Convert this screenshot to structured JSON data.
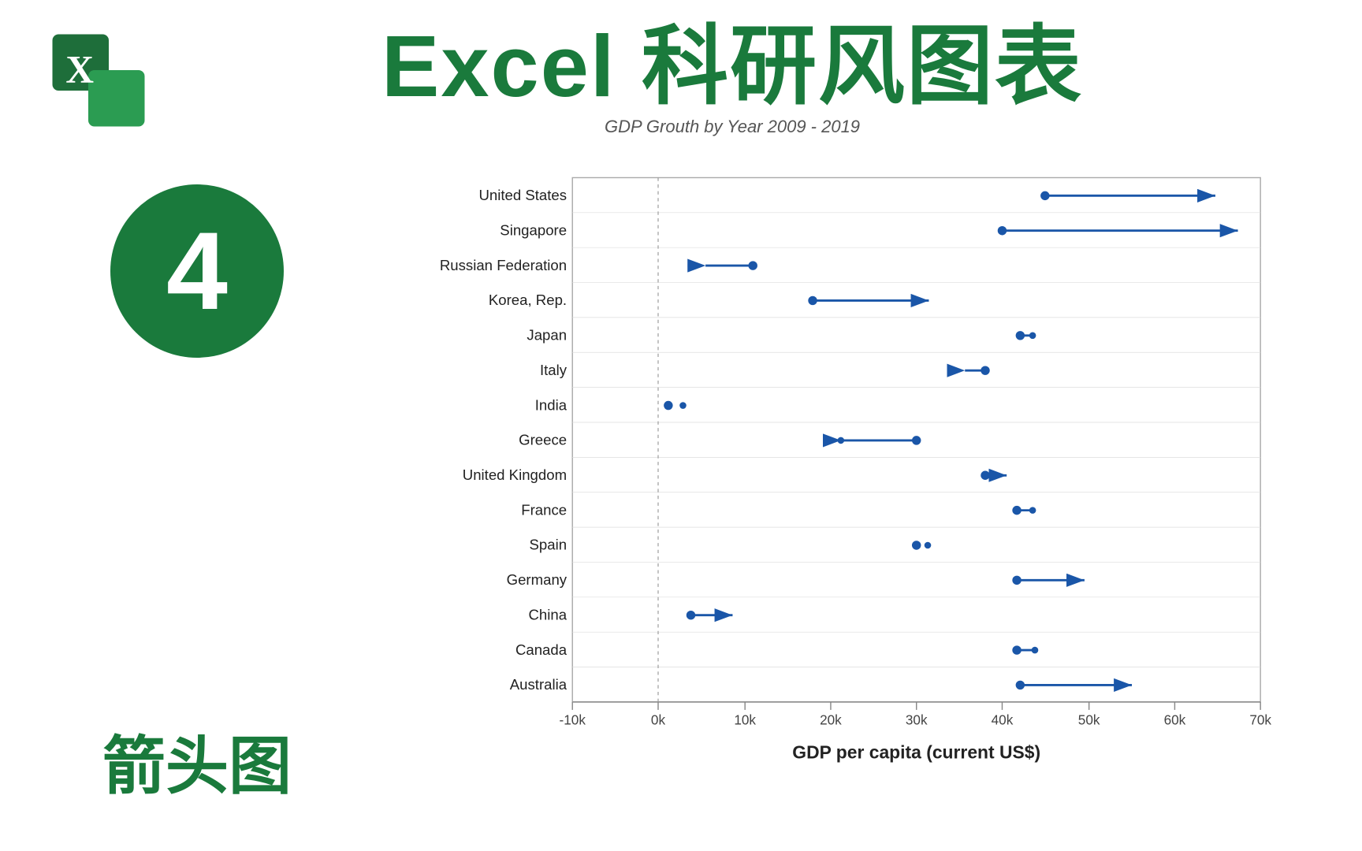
{
  "header": {
    "main_title": "Excel 科研风图表",
    "subtitle": "GDP Grouth by Year 2009 - 2019"
  },
  "left_panel": {
    "number": "4",
    "chart_type": "箭头图"
  },
  "chart": {
    "title": "GDP per capita (current US$)",
    "x_axis_labels": [
      "-10k",
      "0k",
      "10k",
      "20k",
      "30k",
      "40k",
      "50k",
      "60k",
      "70k"
    ],
    "countries": [
      "United States",
      "Singapore",
      "Russian Federation",
      "Korea, Rep.",
      "Japan",
      "Italy",
      "India",
      "Greece",
      "United Kingdom",
      "France",
      "Spain",
      "Germany",
      "China",
      "Canada",
      "Australia"
    ],
    "arrows": [
      {
        "country": "United States",
        "start": 45000,
        "end": 65000
      },
      {
        "country": "Singapore",
        "start": 40000,
        "end": 67000
      },
      {
        "country": "Russian Federation",
        "start": 11000,
        "end": 10000
      },
      {
        "country": "Korea, Rep.",
        "start": 18000,
        "end": 32000
      },
      {
        "country": "Japan",
        "start": 42000,
        "end": 43000
      },
      {
        "country": "Italy",
        "start": 38000,
        "end": 37000
      },
      {
        "country": "India",
        "start": 1200,
        "end": 1400
      },
      {
        "country": "Greece",
        "start": 30000,
        "end": 28000
      },
      {
        "country": "United Kingdom",
        "start": 38000,
        "end": 42000
      },
      {
        "country": "France",
        "start": 41000,
        "end": 43000
      },
      {
        "country": "Spain",
        "start": 30000,
        "end": 31000
      },
      {
        "country": "Germany",
        "start": 41000,
        "end": 46000
      },
      {
        "country": "China",
        "start": 3700,
        "end": 9000
      },
      {
        "country": "Canada",
        "start": 41000,
        "end": 46000
      },
      {
        "country": "Australia",
        "start": 42000,
        "end": 55000
      }
    ]
  }
}
